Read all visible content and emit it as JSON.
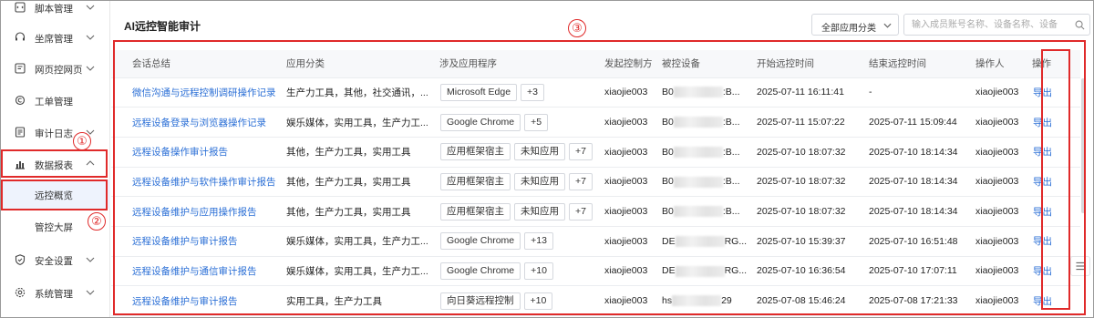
{
  "sidebar": {
    "items": [
      {
        "label": "脚本管理",
        "icon": "script-icon",
        "expandable": true
      },
      {
        "label": "坐席管理",
        "icon": "headset-icon",
        "expandable": true
      },
      {
        "label": "网页控网页",
        "icon": "webpage-icon",
        "expandable": true
      },
      {
        "label": "工单管理",
        "icon": "ticket-icon",
        "expandable": false
      },
      {
        "label": "审计日志",
        "icon": "log-icon",
        "expandable": true
      },
      {
        "label": "数据报表",
        "icon": "bar-chart-icon",
        "expandable": true,
        "expanded": true
      },
      {
        "label": "远控概览",
        "sub": true,
        "active": true
      },
      {
        "label": "管控大屏",
        "sub": true
      },
      {
        "label": "安全设置",
        "icon": "shield-icon",
        "expandable": true
      },
      {
        "label": "系统管理",
        "icon": "gear-icon",
        "expandable": true
      }
    ]
  },
  "annotations": {
    "marker1": "①",
    "marker2": "②",
    "marker3": "③",
    "color": "#e02a2a"
  },
  "main": {
    "title": "AI远控智能审计",
    "filter": {
      "selected": "全部应用分类"
    },
    "search": {
      "placeholder": "输入成员账号名称、设备名称、设备"
    },
    "accent_color": "#2b6fd6"
  },
  "table": {
    "columns": [
      "会话总结",
      "应用分类",
      "涉及应用程序",
      "发起控制方",
      "被控设备",
      "开始远控时间",
      "结束远控时间",
      "操作人",
      "操作"
    ],
    "rows": [
      {
        "summary": "微信沟通与远程控制调研操作记录",
        "category": "生产力工具，其他，社交通讯，...",
        "apps": [
          "Microsoft Edge",
          "+3"
        ],
        "initiator": "xiaojie003",
        "device_pre": "B0",
        "device_post": ":B...",
        "start": "2025-07-11 16:11:41",
        "end": "-",
        "operator": "xiaojie003",
        "action": "导出"
      },
      {
        "summary": "远程设备登录与浏览器操作记录",
        "category": "娱乐媒体，实用工具，生产力工...",
        "apps": [
          "Google Chrome",
          "+5"
        ],
        "initiator": "xiaojie003",
        "device_pre": "B0",
        "device_post": ":B...",
        "start": "2025-07-11 15:07:22",
        "end": "2025-07-11 15:09:44",
        "operator": "xiaojie003",
        "action": "导出"
      },
      {
        "summary": "远程设备操作审计报告",
        "category": "其他，生产力工具，实用工具",
        "apps": [
          "应用框架宿主",
          "未知应用",
          "+7"
        ],
        "initiator": "xiaojie003",
        "device_pre": "B0",
        "device_post": ":B...",
        "start": "2025-07-10 18:07:32",
        "end": "2025-07-10 18:14:34",
        "operator": "xiaojie003",
        "action": "导出"
      },
      {
        "summary": "远程设备维护与软件操作审计报告",
        "category": "其他，生产力工具，实用工具",
        "apps": [
          "应用框架宿主",
          "未知应用",
          "+7"
        ],
        "initiator": "xiaojie003",
        "device_pre": "B0",
        "device_post": ":B...",
        "start": "2025-07-10 18:07:32",
        "end": "2025-07-10 18:14:34",
        "operator": "xiaojie003",
        "action": "导出"
      },
      {
        "summary": "远程设备维护与应用操作报告",
        "category": "其他，生产力工具，实用工具",
        "apps": [
          "应用框架宿主",
          "未知应用",
          "+7"
        ],
        "initiator": "xiaojie003",
        "device_pre": "B0",
        "device_post": ":B...",
        "start": "2025-07-10 18:07:32",
        "end": "2025-07-10 18:14:34",
        "operator": "xiaojie003",
        "action": "导出"
      },
      {
        "summary": "远程设备维护与审计报告",
        "category": "娱乐媒体，实用工具，生产力工...",
        "apps": [
          "Google Chrome",
          "+13"
        ],
        "initiator": "xiaojie003",
        "device_pre": "DE",
        "device_post": "RG...",
        "start": "2025-07-10 15:39:37",
        "end": "2025-07-10 16:51:48",
        "operator": "xiaojie003",
        "action": "导出"
      },
      {
        "summary": "远程设备维护与通信审计报告",
        "category": "娱乐媒体，实用工具，生产力工...",
        "apps": [
          "Google Chrome",
          "+10"
        ],
        "initiator": "xiaojie003",
        "device_pre": "DE",
        "device_post": "RG...",
        "start": "2025-07-10 16:36:54",
        "end": "2025-07-10 17:07:11",
        "operator": "xiaojie003",
        "action": "导出"
      },
      {
        "summary": "远程设备维护与审计报告",
        "category": "实用工具，生产力工具",
        "apps": [
          "向日葵远程控制",
          "+10"
        ],
        "initiator": "xiaojie003",
        "device_pre": "hs",
        "device_post": "29",
        "start": "2025-07-08 15:46:24",
        "end": "2025-07-08 17:21:33",
        "operator": "xiaojie003",
        "action": "导出"
      }
    ]
  }
}
